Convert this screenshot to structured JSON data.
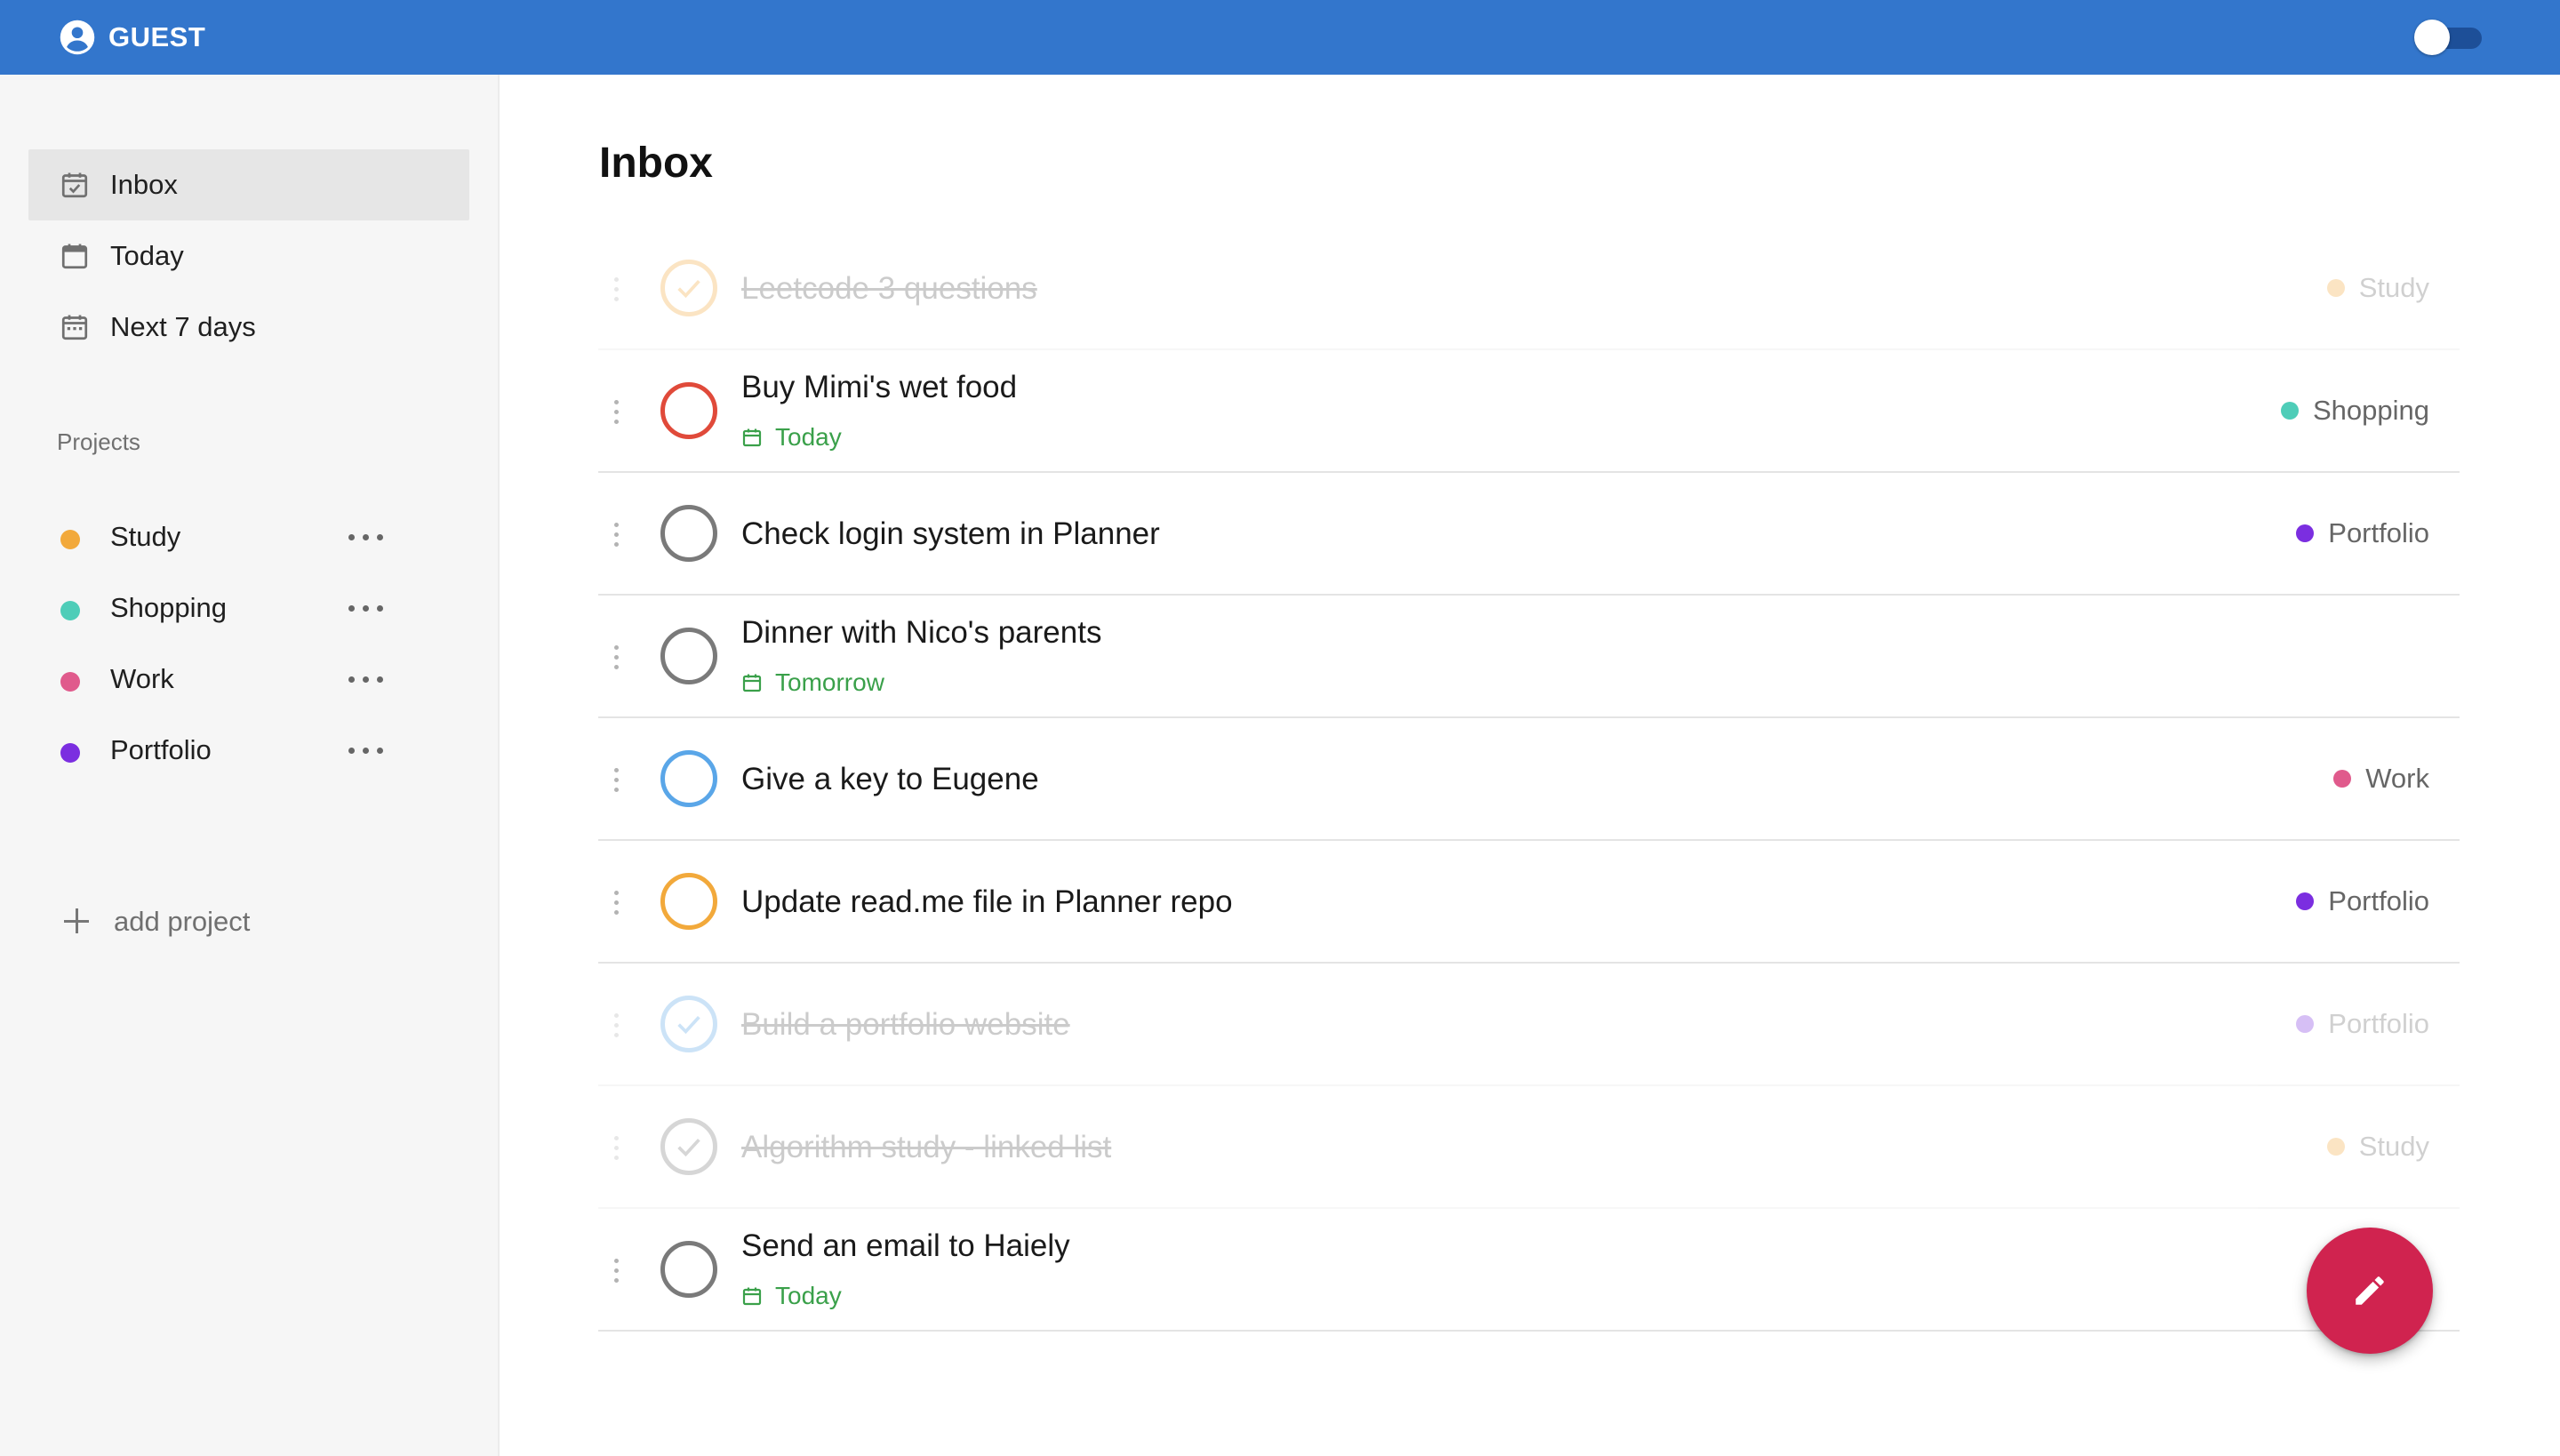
{
  "header": {
    "user_name": "GUEST",
    "user_icon": "account-circle-icon",
    "theme_toggle_on": false,
    "color": "#3376cc"
  },
  "sidebar": {
    "nav": [
      {
        "label": "Inbox",
        "icon": "inbox-check-icon",
        "active": true
      },
      {
        "label": "Today",
        "icon": "calendar-icon",
        "active": false
      },
      {
        "label": "Next 7 days",
        "icon": "calendar-week-icon",
        "active": false
      }
    ],
    "projects_title": "Projects",
    "projects": [
      {
        "label": "Study",
        "color": "#f2a93b"
      },
      {
        "label": "Shopping",
        "color": "#4ecdb8"
      },
      {
        "label": "Work",
        "color": "#e05a8c"
      },
      {
        "label": "Portfolio",
        "color": "#7b2ee0"
      }
    ],
    "add_project_label": "add project"
  },
  "main": {
    "title": "Inbox",
    "tasks": [
      {
        "title": "Leetcode 3 questions",
        "done": true,
        "ring_color": "#f2a93b",
        "project": "Study",
        "project_color": "#f2a93b"
      },
      {
        "title": "Buy Mimi's wet food",
        "done": false,
        "ring_color": "#e04a3a",
        "due": "Today",
        "project": "Shopping",
        "project_color": "#4ecdb8"
      },
      {
        "title": "Check login system in Planner",
        "done": false,
        "ring_color": "#7a7a7a",
        "project": "Portfolio",
        "project_color": "#7b2ee0"
      },
      {
        "title": "Dinner with Nico's parents",
        "done": false,
        "ring_color": "#7a7a7a",
        "due": "Tomorrow"
      },
      {
        "title": "Give a key to Eugene",
        "done": false,
        "ring_color": "#5aa6e8",
        "project": "Work",
        "project_color": "#e05a8c"
      },
      {
        "title": "Update read.me file in Planner repo",
        "done": false,
        "ring_color": "#f2a93b",
        "project": "Portfolio",
        "project_color": "#7b2ee0"
      },
      {
        "title": "Build a portfolio website",
        "done": true,
        "ring_color": "#5aa6e8",
        "project": "Portfolio",
        "project_color": "#7b2ee0"
      },
      {
        "title": "Algorithm study - linked list",
        "done": true,
        "ring_color": "#7a7a7a",
        "project": "Study",
        "project_color": "#f2a93b"
      },
      {
        "title": "Send an email to Haiely",
        "done": false,
        "ring_color": "#7a7a7a",
        "due": "Today"
      }
    ]
  },
  "fab": {
    "icon": "pencil-icon",
    "color": "#d0234f"
  }
}
